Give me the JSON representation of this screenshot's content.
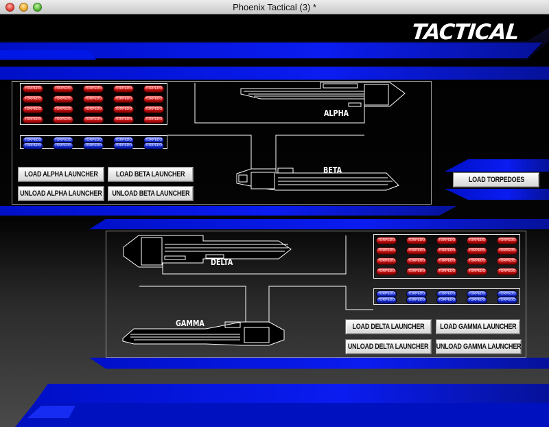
{
  "window": {
    "title": "Phoenix Tactical (3) *"
  },
  "header": {
    "title": "TACTICAL"
  },
  "colors": {
    "accent": "#0a1cf0",
    "red_tube": "#d01818",
    "blue_tube": "#1c2fd8",
    "background": "#000000"
  },
  "upper_panel": {
    "ships": [
      "ALPHA",
      "BETA"
    ],
    "red_tubes": {
      "rows": 4,
      "cols": 5,
      "label": "TORPEDO"
    },
    "blue_tubes": {
      "rows": 2,
      "cols": 5,
      "label": "TORPEDO"
    },
    "buttons": {
      "load_alpha": "LOAD ALPHA LAUNCHER",
      "load_beta": "LOAD BETA LAUNCHER",
      "unload_alpha": "UNLOAD ALPHA LAUNCHER",
      "unload_beta": "UNLOAD BETA LAUNCHER"
    }
  },
  "side": {
    "load_torpedoes": "LOAD TORPEDOES"
  },
  "lower_panel": {
    "ships": [
      "DELTA",
      "GAMMA"
    ],
    "red_tubes": {
      "rows": 4,
      "cols": 5,
      "label": "TORPEDO"
    },
    "blue_tubes": {
      "rows": 2,
      "cols": 5,
      "label": "TORPEDO"
    },
    "buttons": {
      "load_delta": "LOAD DELTA LAUNCHER",
      "load_gamma": "LOAD GAMMA LAUNCHER",
      "unload_delta": "UNLOAD DELTA LAUNCHER",
      "unload_gamma": "UNLOAD GAMMA LAUNCHER"
    }
  }
}
